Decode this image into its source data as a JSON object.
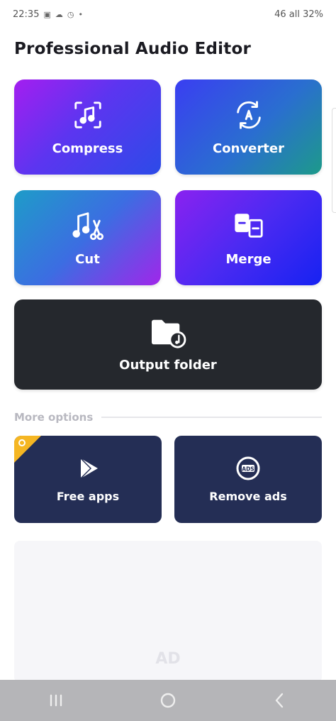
{
  "status_bar": {
    "time": "22:35",
    "left_icons": [
      "gallery-icon",
      "cloud-icon",
      "alarm-icon",
      "dot-icon"
    ],
    "right_text": "46 all 32%"
  },
  "page": {
    "title": "Professional Audio Editor"
  },
  "tiles": {
    "compress": {
      "label": "Compress",
      "icon": "compress-music-icon"
    },
    "converter": {
      "label": "Converter",
      "icon": "convert-cycle-icon"
    },
    "cut": {
      "label": "Cut",
      "icon": "music-scissors-icon"
    },
    "merge": {
      "label": "Merge",
      "icon": "merge-files-icon"
    },
    "output": {
      "label": "Output folder",
      "icon": "music-folder-icon"
    }
  },
  "more_options": {
    "label": "More options",
    "free_apps": {
      "label": "Free apps",
      "icon": "play-store-icon"
    },
    "remove_ads": {
      "label": "Remove ads",
      "icon": "ads-icon"
    }
  },
  "ad": {
    "label": "AD"
  },
  "nav": {
    "recent": "recent-apps-icon",
    "home": "home-icon",
    "back": "back-icon"
  },
  "colors": {
    "output_tile": "#25282d",
    "small_tile": "#242e55",
    "badge": "#f5b623",
    "nav_bar": "#b5b5b8"
  }
}
